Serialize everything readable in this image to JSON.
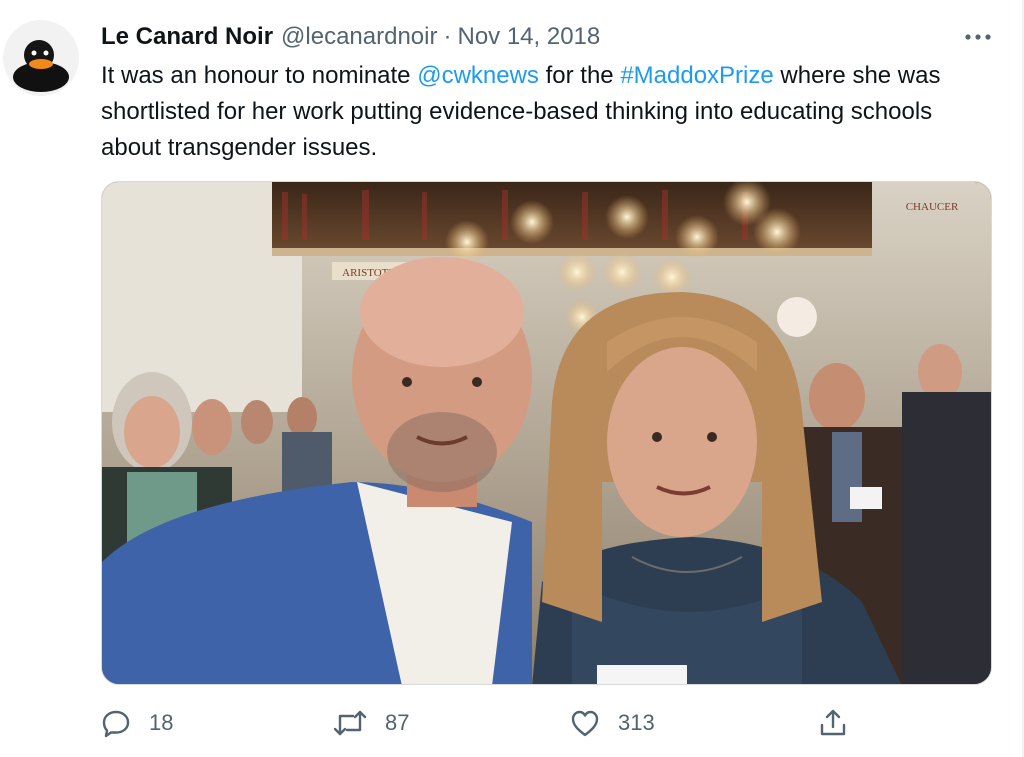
{
  "tweet": {
    "author": {
      "display_name": "Le Canard Noir",
      "handle": "@lecanardnoir",
      "avatar_icon": "black-duck-avatar"
    },
    "separator": "·",
    "date": "Nov 14, 2018",
    "text": {
      "part1": "It was an honour to nominate ",
      "mention": "@cwknews",
      "part2": " for the ",
      "hashtag": "#MaddoxPrize",
      "part3": " where she was shortlisted for her work putting evidence-based thinking into educating schools about transgender issues."
    },
    "link_color": "#1d9bf0",
    "photo": {
      "sign_left": "ARISTOTLE",
      "sign_right": "CHAUCER"
    },
    "actions": {
      "reply_count": "18",
      "retweet_count": "87",
      "like_count": "313"
    }
  }
}
